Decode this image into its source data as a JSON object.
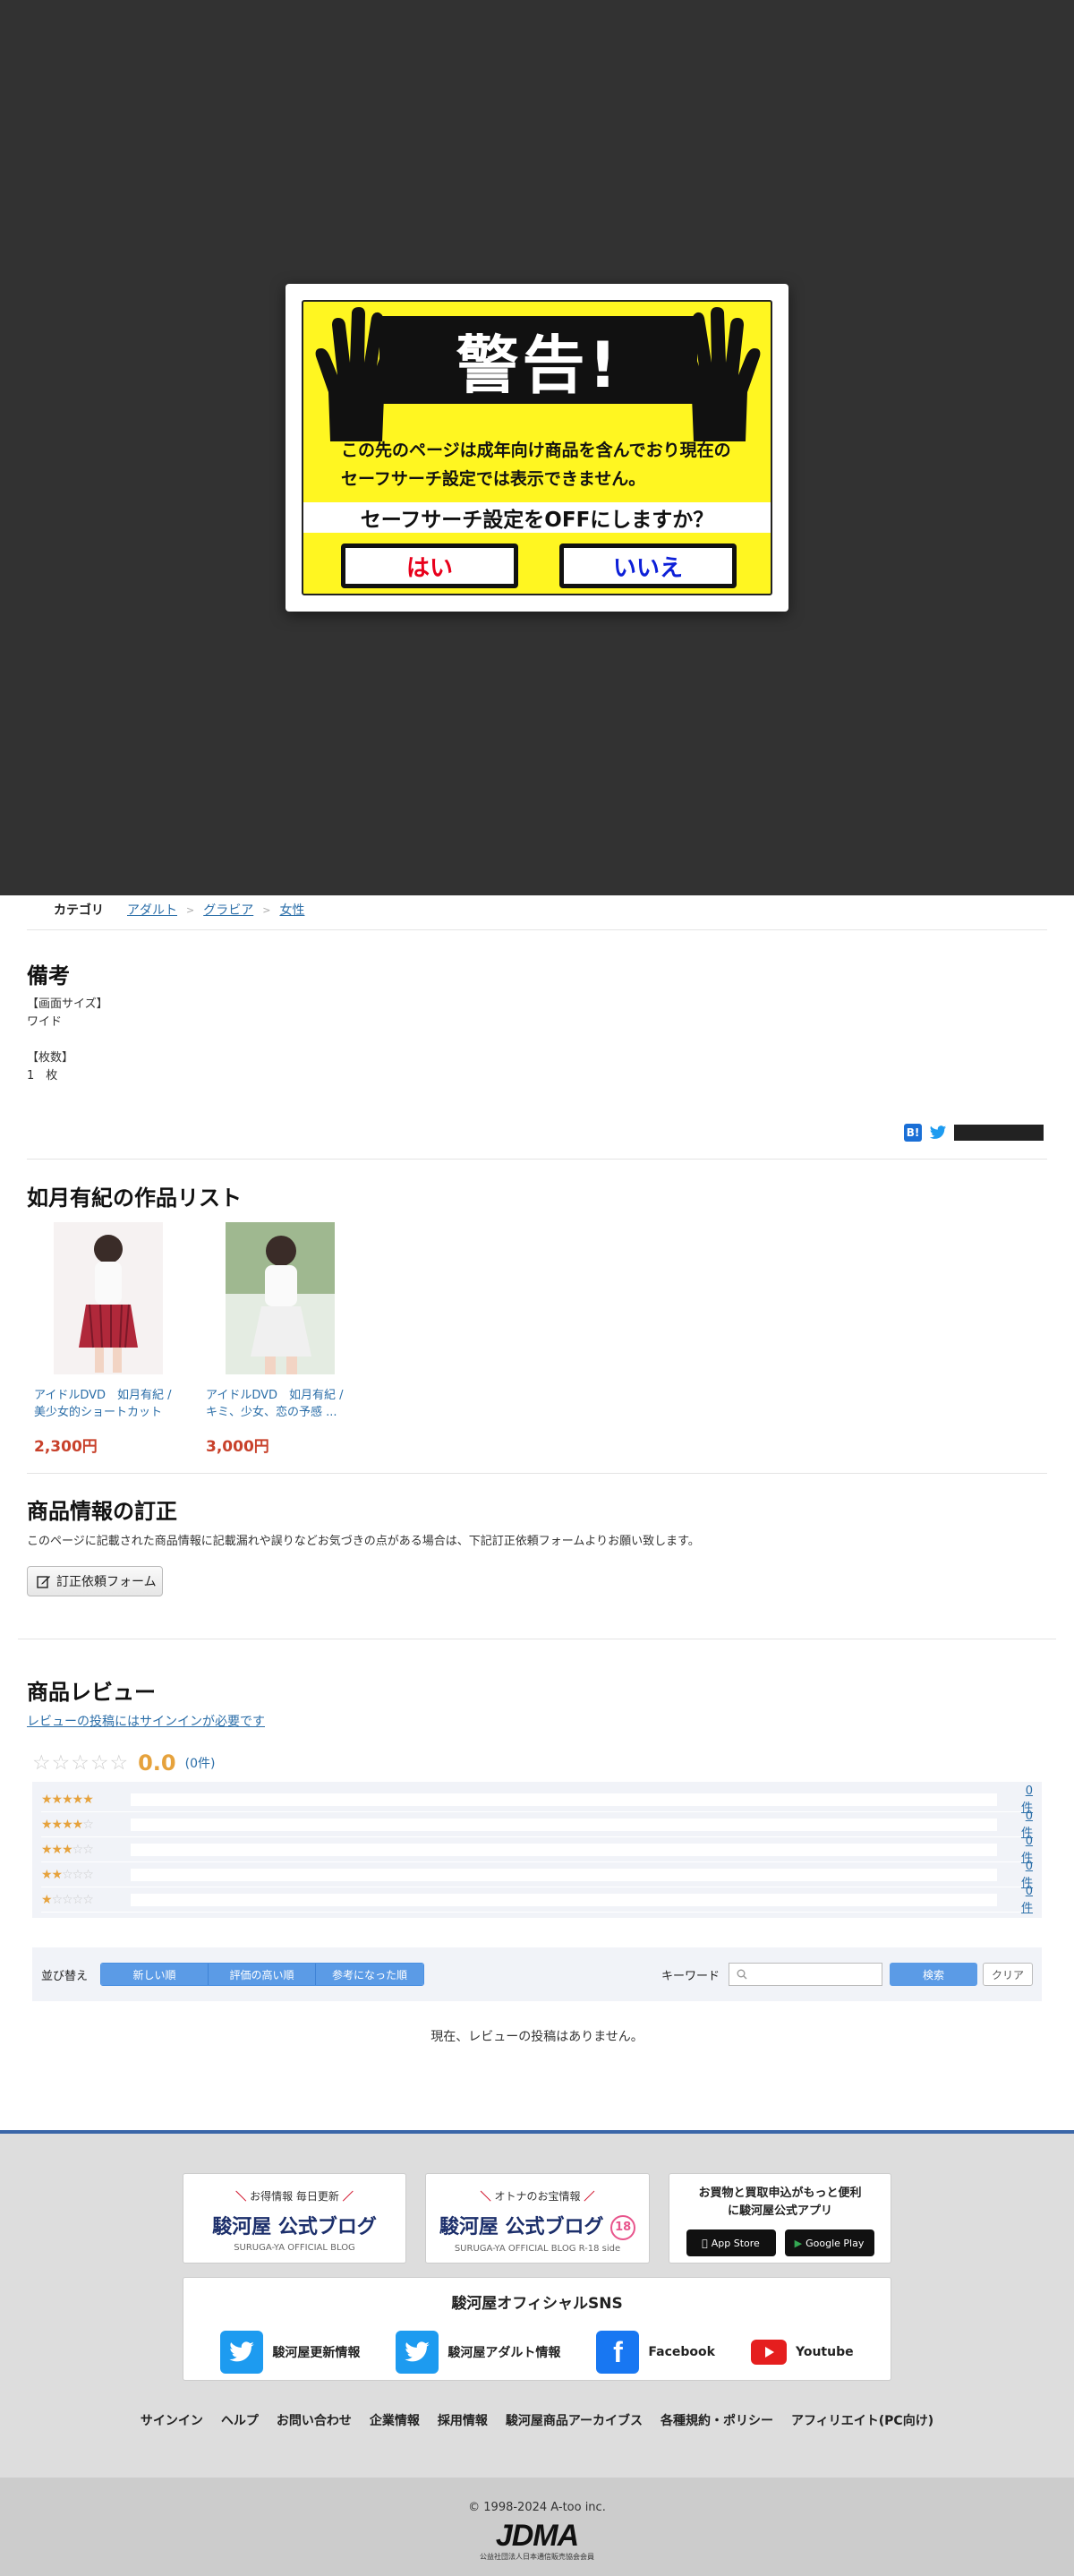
{
  "warning": {
    "title": "警告!",
    "message_line1": "この先のページは成年向け商品を含んでおり現在の",
    "message_line2": "セーフサーチ設定では表示できません。",
    "question": "セーフサーチ設定をOFFにしますか？",
    "yes_label": "はい",
    "no_label": "いいえ",
    "yes_color": "#e8001b",
    "no_color": "#0d20d8"
  },
  "category": {
    "label": "カテゴリ",
    "crumbs": [
      "アダルト",
      "グラビア",
      "女性"
    ]
  },
  "notes": {
    "heading": "備考",
    "line1": "【画面サイズ】",
    "line2": "ワイド",
    "line3": "【枚数】",
    "line4": "1　枚"
  },
  "works": {
    "heading": "如月有紀の作品リスト",
    "items": [
      {
        "title": "アイドルDVD　如月有紀 / 美少女的ショートカット",
        "price": "2,300円"
      },
      {
        "title": "アイドルDVD　如月有紀 / キミ、少女、恋の予感 ...",
        "price": "3,000円"
      }
    ]
  },
  "correction": {
    "heading": "商品情報の訂正",
    "text": "このページに記載された商品情報に記載漏れや誤りなどお気づきの点がある場合は、下記訂正依頼フォームよりお願い致します。",
    "button_label": "訂正依頼フォーム"
  },
  "reviews": {
    "heading": "商品レビュー",
    "signin_link": "レビューの投稿にはサインインが必要です",
    "average": "0.0",
    "count": "(0件)",
    "distribution": [
      "0件",
      "0件",
      "0件",
      "0件",
      "0件"
    ],
    "sort_label": "並び替え",
    "sort_options": [
      "新しい順",
      "評価の高い順",
      "参考になった順"
    ],
    "keyword_label": "キーワード",
    "search_label": "検索",
    "clear_label": "クリア",
    "empty_text": "現在、レビューの投稿はありません。"
  },
  "footer": {
    "blog1": {
      "top": "お得情報 毎日更新",
      "main": "駿河屋 公式ブログ",
      "sub": "SURUGA-YA OFFICIAL BLOG"
    },
    "blog2": {
      "top": "オトナのお宝情報",
      "main": "駿河屋 公式ブログ",
      "sub": "SURUGA-YA OFFICIAL BLOG R-18 side",
      "badge": "18"
    },
    "app": {
      "line1": "お買物と買取申込がもっと便利",
      "line2": "に駿河屋公式アプリ",
      "appstore": "App Store",
      "googleplay": "Google Play"
    },
    "sns_title": "駿河屋オフィシャルSNS",
    "sns": [
      {
        "label": "駿河屋更新情報",
        "icon": "twitter-icon"
      },
      {
        "label": "駿河屋アダルト情報",
        "icon": "twitter-icon"
      },
      {
        "label": "Facebook",
        "icon": "facebook-icon"
      },
      {
        "label": "Youtube",
        "icon": "youtube-icon"
      }
    ],
    "links": [
      "サインイン",
      "ヘルプ",
      "お問い合わせ",
      "企業情報",
      "採用情報",
      "駿河屋商品アーカイブス",
      "各種規約・ポリシー",
      "アフィリエイト(PC向け)"
    ],
    "copyright": "© 1998-2024 A-too inc.",
    "jdma": "JDMA",
    "jdma_sub": "公益社団法人日本通信販売協会会員"
  }
}
